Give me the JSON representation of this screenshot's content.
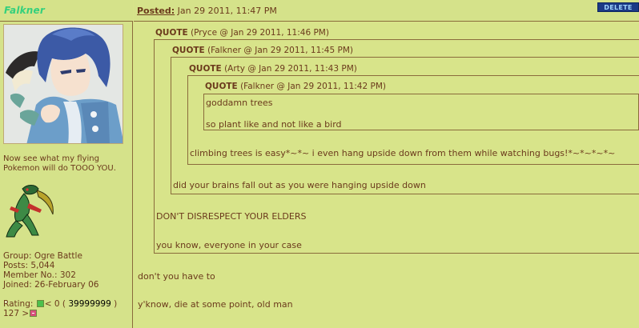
{
  "user": {
    "username": "Falkner",
    "custom_title": "Now see what my flying Pokemon will do TOOO YOU.",
    "group": "Group: Ogre Battle",
    "posts": "Posts: 5,044",
    "member_no": "Member No.: 302",
    "joined": "Joined: 26-February 06",
    "rating_label": "Rating:",
    "rating_low": "< 0 (",
    "rating_value": "39999999",
    "rating_close": ")",
    "rating_high": "127 >"
  },
  "post": {
    "posted_label": "Posted:",
    "posted_time": "Jan 29 2011, 11:47 PM",
    "delete_label": "DELETE",
    "quotes": [
      {
        "label": "QUOTE",
        "meta": "(Pryce @ Jan 29 2011, 11:46 PM)"
      },
      {
        "label": "QUOTE",
        "meta": "(Falkner @ Jan 29 2011, 11:45 PM)"
      },
      {
        "label": "QUOTE",
        "meta": "(Arty @ Jan 29 2011, 11:43 PM)"
      },
      {
        "label": "QUOTE",
        "meta": "(Falkner @ Jan 29 2011, 11:42 PM)"
      }
    ],
    "q4_line1": "goddamn trees",
    "q4_line2": "so plant like and not like a bird",
    "q3_text": "climbing trees is easy*~*~ i even hang upside down from them while watching bugs!*~*~*~*~",
    "q2_text": "did your brains fall out as you were hanging upside down",
    "q1_line1": "DON'T DISRESPECT YOUR ELDERS",
    "q1_line2": "you know, everyone in your case",
    "body_line1": "don't you have to",
    "body_line2": "y'know, die at some point, old man"
  },
  "colors": {
    "background": "#d8e48a",
    "text": "#6b3a1c",
    "username": "#34d07c",
    "delete_button": "#1c3a86"
  }
}
